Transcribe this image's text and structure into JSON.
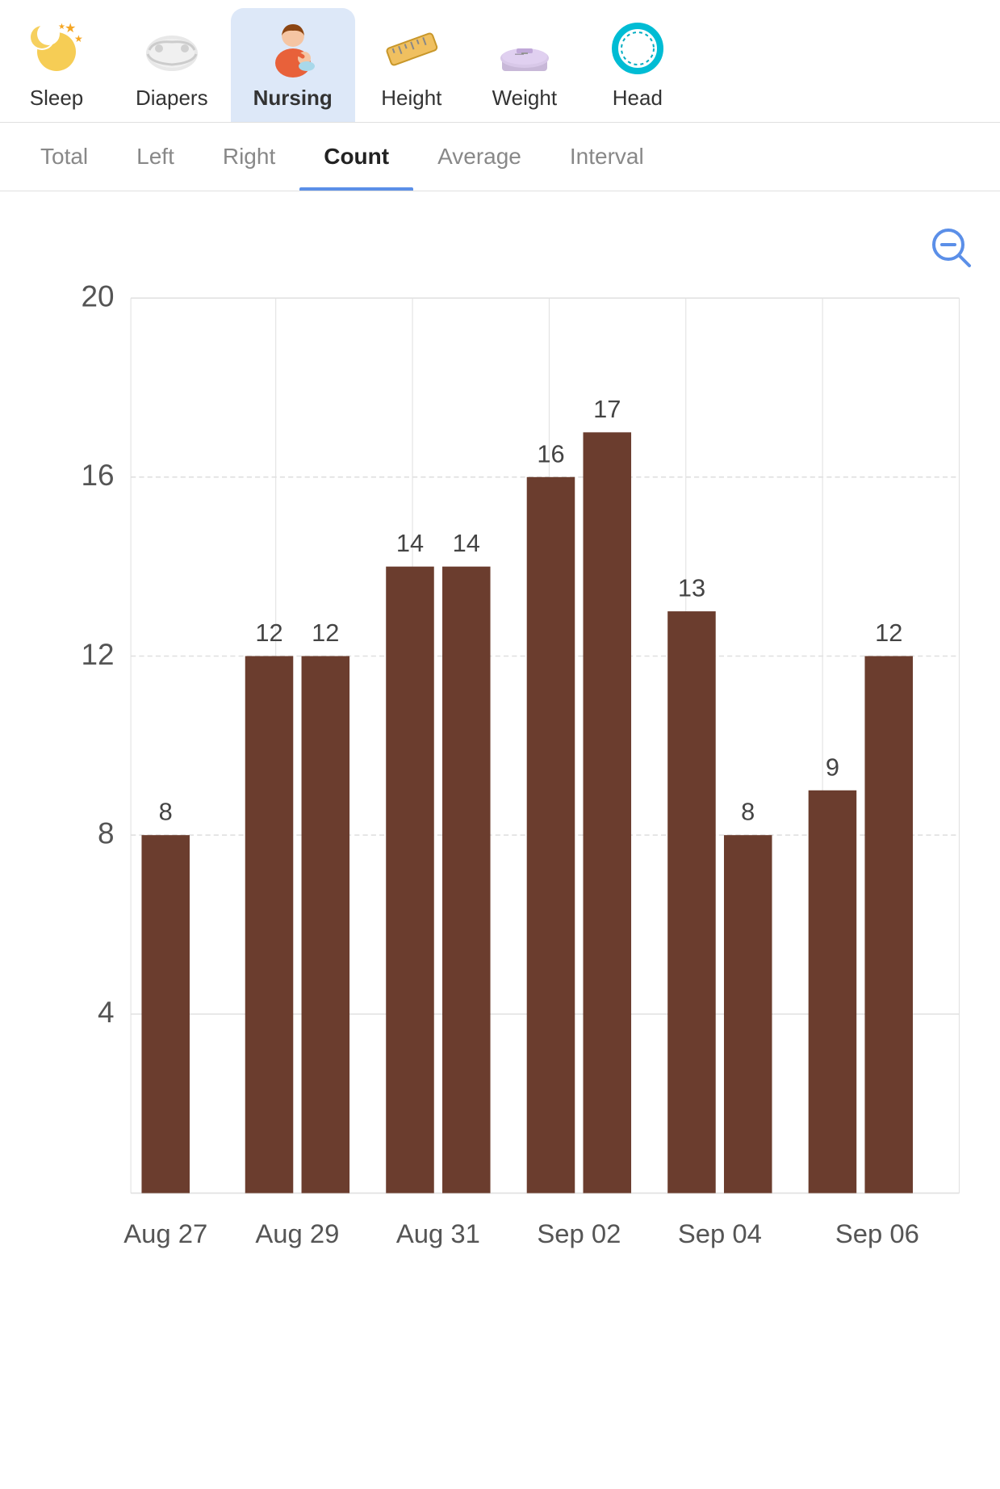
{
  "nav": {
    "items": [
      {
        "id": "sleep",
        "label": "Sleep",
        "icon": "🌙",
        "active": false
      },
      {
        "id": "diapers",
        "label": "Diapers",
        "icon": "🍼",
        "active": false
      },
      {
        "id": "nursing",
        "label": "Nursing",
        "icon": "🤱",
        "active": true
      },
      {
        "id": "height",
        "label": "Height",
        "icon": "📏",
        "active": false
      },
      {
        "id": "weight",
        "label": "Weight",
        "icon": "⚖️",
        "active": false
      },
      {
        "id": "head",
        "label": "Head",
        "icon": "📐",
        "active": false
      }
    ]
  },
  "tabs": [
    {
      "id": "total",
      "label": "Total",
      "active": false
    },
    {
      "id": "left",
      "label": "Left",
      "active": false
    },
    {
      "id": "right",
      "label": "Right",
      "active": false
    },
    {
      "id": "count",
      "label": "Count",
      "active": true
    },
    {
      "id": "average",
      "label": "Average",
      "active": false
    },
    {
      "id": "interval",
      "label": "Interval",
      "active": false
    }
  ],
  "chart": {
    "yLabels": [
      "20",
      "16",
      "12",
      "8",
      "4"
    ],
    "yMax": 20,
    "bars": [
      {
        "date": "Aug 27",
        "value": 8
      },
      {
        "date": "Aug 29",
        "value": 12
      },
      {
        "date": "Aug 29b",
        "value": 12
      },
      {
        "date": "Aug 31",
        "value": 14
      },
      {
        "date": "Aug 31b",
        "value": 14
      },
      {
        "date": "Sep 02",
        "value": 16
      },
      {
        "date": "Sep 02b",
        "value": 17
      },
      {
        "date": "Sep 04",
        "value": 13
      },
      {
        "date": "Sep 04b",
        "value": 8
      },
      {
        "date": "Sep 06",
        "value": 9
      },
      {
        "date": "Sep 06b",
        "value": 12
      }
    ],
    "xLabels": [
      "Aug 27",
      "Aug 29",
      "Aug 31",
      "Sep 02",
      "Sep 04",
      "Sep 06"
    ],
    "zoomLabel": "zoom-out"
  }
}
